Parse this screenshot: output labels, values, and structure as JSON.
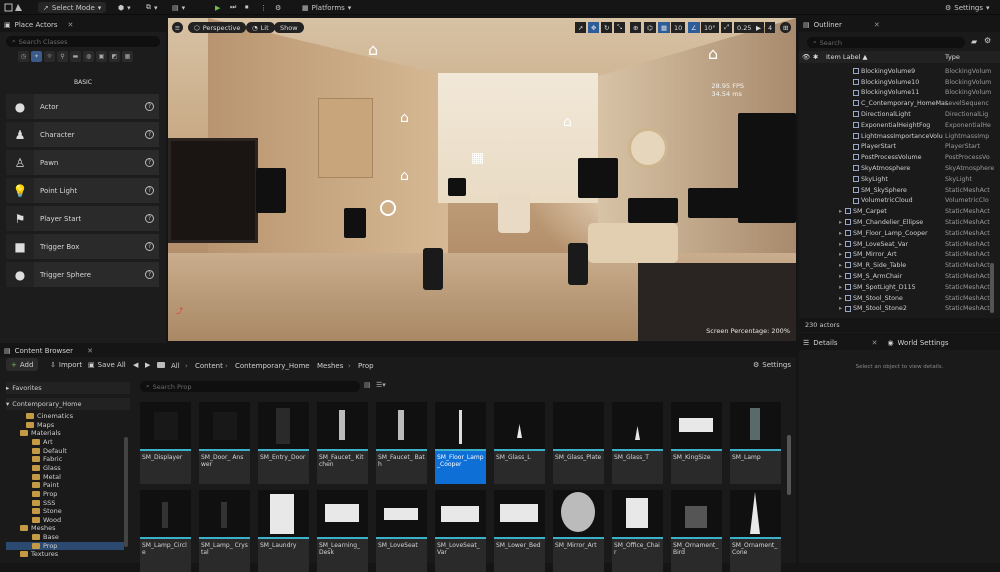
{
  "toolbar": {
    "mode_label": "Select Mode",
    "platforms_label": "Platforms",
    "settings_label": "Settings"
  },
  "place_actors": {
    "tab_label": "Place Actors",
    "search_placeholder": "Search Classes",
    "category_label": "BASIC",
    "actors": [
      "Actor",
      "Character",
      "Pawn",
      "Point Light",
      "Player Start",
      "Trigger Box",
      "Trigger Sphere"
    ]
  },
  "viewport": {
    "perspective_label": "Perspective",
    "lit_label": "Lit",
    "show_label": "Show",
    "grid_value": "10",
    "angle_value": "10°",
    "scale_value": "0.25",
    "camera_speed": "4",
    "fps": "28.95 FPS",
    "ms": "34.54 ms",
    "screen_percentage": "Screen Percentage: 200%"
  },
  "outliner": {
    "tab_label": "Outliner",
    "search_placeholder": "Search",
    "col_label": "Item Label ▲",
    "col_type": "Type",
    "rows": [
      {
        "name": "BlockingVolume9",
        "type": "BlockingVolum"
      },
      {
        "name": "BlockingVolume10",
        "type": "BlockingVolum"
      },
      {
        "name": "BlockingVolume11",
        "type": "BlockingVolum"
      },
      {
        "name": "C_Contemporary_HomeMas",
        "type": "LevelSequenc"
      },
      {
        "name": "DirectionalLight",
        "type": "DirectionalLig"
      },
      {
        "name": "ExponentialHeightFog",
        "type": "ExponentialHe"
      },
      {
        "name": "LightmassImportanceVolu",
        "type": "LightmassImp"
      },
      {
        "name": "PlayerStart",
        "type": "PlayerStart"
      },
      {
        "name": "PostProcessVolume",
        "type": "PostProcessVo"
      },
      {
        "name": "SkyAtmosphere",
        "type": "SkyAtmosphere"
      },
      {
        "name": "SkyLight",
        "type": "SkyLight"
      },
      {
        "name": "SM_SkySphere",
        "type": "StaticMeshAct"
      },
      {
        "name": "VolumetricCloud",
        "type": "VolumetricClo"
      },
      {
        "name": "SM_Carpet",
        "type": "StaticMeshAct"
      },
      {
        "name": "SM_Chandelier_Ellipse",
        "type": "StaticMeshAct"
      },
      {
        "name": "SM_Floor_Lamp_Cooper",
        "type": "StaticMeshAct"
      },
      {
        "name": "SM_LoveSeat_Var",
        "type": "StaticMeshAct"
      },
      {
        "name": "SM_Mirror_Art",
        "type": "StaticMeshAct"
      },
      {
        "name": "SM_R_Side_Table",
        "type": "StaticMeshAct"
      },
      {
        "name": "SM_S_ArmChair",
        "type": "StaticMeshAct"
      },
      {
        "name": "SM_SpotLight_D115",
        "type": "StaticMeshAct"
      },
      {
        "name": "SM_Stool_Stone",
        "type": "StaticMeshAct"
      },
      {
        "name": "SM_Stool_Stone2",
        "type": "StaticMeshAct"
      }
    ],
    "count": "230 actors"
  },
  "details": {
    "details_tab": "Details",
    "world_tab": "World Settings",
    "empty_msg": "Select an object to view details."
  },
  "content_browser": {
    "tab_label": "Content Browser",
    "add_label": "Add",
    "import_label": "Import",
    "save_all_label": "Save All",
    "breadcrumb": [
      "All",
      "Content",
      "Contemporary_Home",
      "Meshes",
      "Prop"
    ],
    "settings_label": "Settings",
    "favorites_label": "Favorites",
    "project_label": "Contemporary_Home",
    "search_placeholder": "Search Prop",
    "tree": [
      "Cinematics",
      "Maps",
      "Materials",
      "Art",
      "Default",
      "Fabric",
      "Glass",
      "Metal",
      "Paint",
      "Prop",
      "SSS",
      "Stone",
      "Wood",
      "Meshes",
      "Base",
      "Prop",
      "Textures"
    ],
    "assets_row1": [
      "SM_Displayer",
      "SM_Door_ Answer",
      "SM_Entry_Door",
      "SM_Faucet_ Kitchen",
      "SM_Faucet_ Bath",
      "SM_Floor_Lamp _Cooper",
      "SM_Glass_L",
      "SM_Glass_Plate",
      "SM_Glass_T",
      "SM_KingSize",
      "SM_Lamp"
    ],
    "assets_row2": [
      "SM_Lamp_Circle",
      "SM_Lamp_ Crystal",
      "SM_Laundry",
      "SM_Learning_ Desk",
      "SM_LoveSeat",
      "SM_LoveSeat_ Var",
      "SM_Lower_Bed",
      "SM_Mirror_Art",
      "SM_Office_Chair",
      "SM_Ornament_ Bird",
      "SM_Ornament_ Cone"
    ]
  }
}
